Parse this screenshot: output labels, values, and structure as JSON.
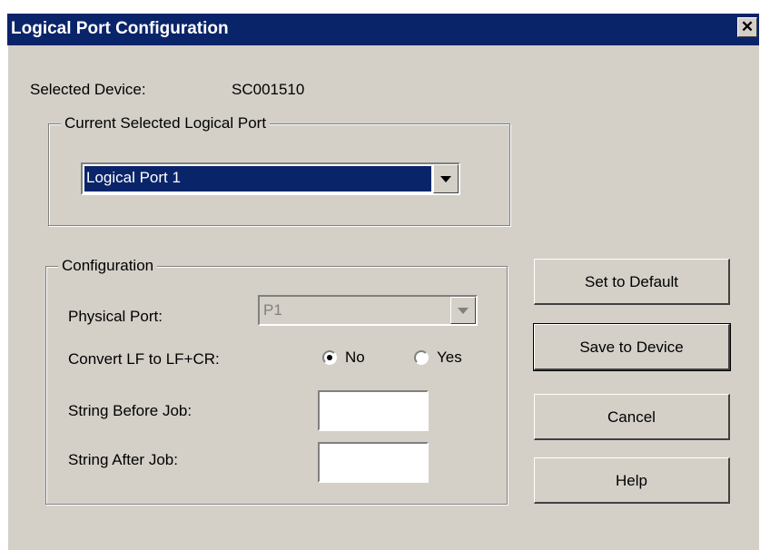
{
  "window": {
    "title": "Logical Port Configuration",
    "close_glyph": "✕"
  },
  "selected_device": {
    "label": "Selected Device:",
    "value": "SC001510"
  },
  "current_port_group": {
    "legend": "Current Selected Logical Port",
    "selected": "Logical Port 1"
  },
  "configuration": {
    "legend": "Configuration",
    "physical_port_label": "Physical Port:",
    "physical_port_value": "P1",
    "convert_label": "Convert LF to LF+CR:",
    "convert_options": [
      "No",
      "Yes"
    ],
    "convert_selected": "No",
    "string_before_label": "String Before Job:",
    "string_before_value": "",
    "string_after_label": "String After Job:",
    "string_after_value": ""
  },
  "buttons": {
    "set_default": "Set to Default",
    "save": "Save to Device",
    "cancel": "Cancel",
    "help": "Help"
  },
  "colors": {
    "titlebar": "#0a246a",
    "dialog_bg": "#d4d0c8",
    "selection": "#0a246a"
  }
}
